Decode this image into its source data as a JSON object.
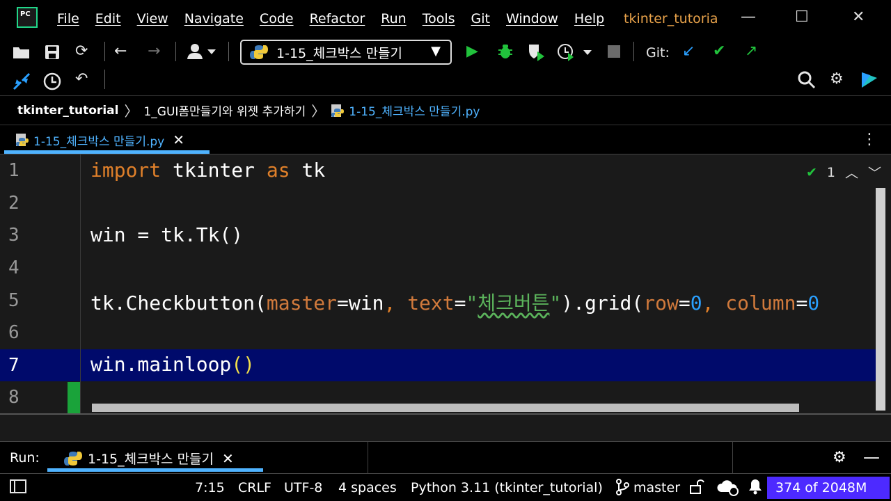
{
  "app": {
    "logo": "PC",
    "project_title": "tkinter_tutoria"
  },
  "menu": [
    "File",
    "Edit",
    "View",
    "Navigate",
    "Code",
    "Refactor",
    "Run",
    "Tools",
    "Git",
    "Window",
    "Help"
  ],
  "window_controls": {
    "minimize": "—",
    "maximize": "☐",
    "close": "✕"
  },
  "toolbar": {
    "run_config": "1-15_체크박스 만들기",
    "git_label": "Git:",
    "icons": [
      "open-folder-icon",
      "save-icon",
      "sync-icon",
      "back-icon",
      "forward-icon",
      "user-menu-icon",
      "run-icon",
      "debug-icon",
      "coverage-icon",
      "profile-icon",
      "stop-icon",
      "git-update-icon",
      "git-commit-icon",
      "git-push-icon",
      "git-pull-requests-icon",
      "history-icon",
      "rollback-icon",
      "search-icon",
      "settings-icon",
      "jetbrains-toolbox-icon"
    ]
  },
  "breadcrumb": {
    "project": "tkinter_tutorial",
    "folder": "1_GUI폼만들기와 위젯 추가하기",
    "file": "1-15_체크박스 만들기.py"
  },
  "tabs": [
    {
      "label": "1-15_체크박스 만들기.py",
      "active": true
    }
  ],
  "editor": {
    "line_numbers": [
      "1",
      "2",
      "3",
      "4",
      "5",
      "6",
      "7",
      "8"
    ],
    "current_line": "7",
    "inspection_count": "1",
    "code": {
      "l1": {
        "kw1": "import",
        "t1": " tkinter ",
        "kw2": "as",
        "t2": " tk"
      },
      "l3": "win = tk.Tk()",
      "l5": {
        "t1": "tk.Checkbutton(",
        "p1": "master",
        "t2": "=win",
        "c1": ", ",
        "p2": "text",
        "t3": "=",
        "s1": "\"",
        "s2": "체크버튼",
        "s3": "\"",
        "t4": ").grid(",
        "p3": "row",
        "t5": "=",
        "n1": "0",
        "c2": ", ",
        "p4": "column",
        "t6": "=",
        "n2": "0"
      },
      "l7": {
        "t1": "win.mainloop",
        "b1": "()"
      }
    }
  },
  "run_panel": {
    "label": "Run:",
    "tab": "1-15_체크박스 만들기"
  },
  "status_bar": {
    "position": "7:15",
    "line_ending": "CRLF",
    "encoding": "UTF-8",
    "indent": "4 spaces",
    "interpreter": "Python 3.11 (tkinter_tutorial)",
    "branch": "master",
    "memory": "374 of 2048M"
  },
  "colors": {
    "accent_blue": "#4fb3ff",
    "run_green": "#21c23c",
    "current_line": "#000a6b",
    "memory_bar": "#4d2aff"
  }
}
